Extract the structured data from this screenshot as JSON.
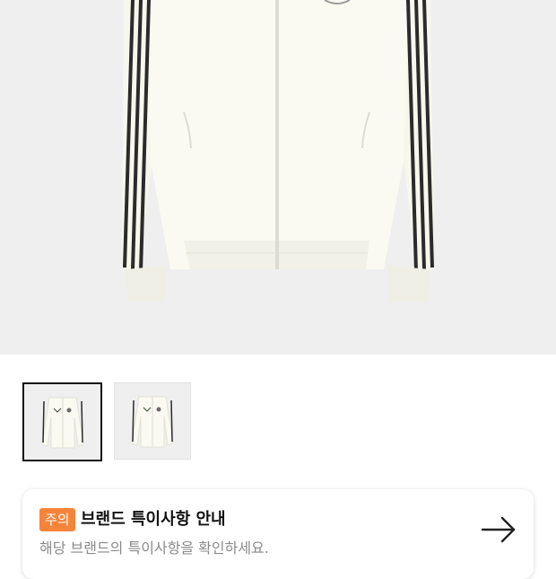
{
  "product": {
    "main_image": "white-track-jacket",
    "thumbnails": [
      {
        "name": "jacket-front-view",
        "selected": true
      },
      {
        "name": "jacket-alt-view",
        "selected": false
      }
    ]
  },
  "notice": {
    "badge": "주의",
    "title": "브랜드 특이사항 안내",
    "description": "해당 브랜드의 특이사항을 확인하세요.",
    "arrow_icon": "arrow-right-icon"
  },
  "colors": {
    "badge": "#f5843a",
    "image_bg": "#efefef"
  }
}
